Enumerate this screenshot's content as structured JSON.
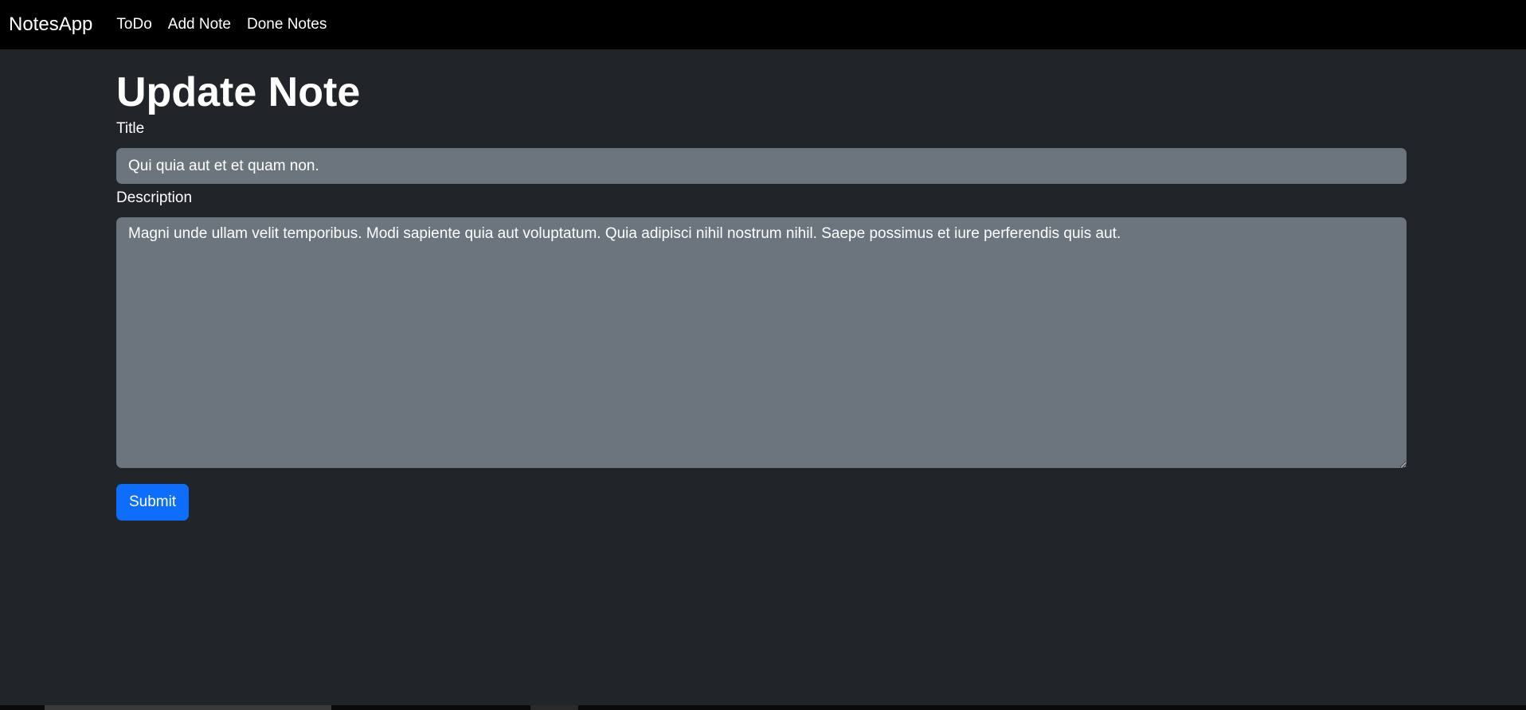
{
  "navbar": {
    "brand": "NotesApp",
    "links": [
      "ToDo",
      "Add Note",
      "Done Notes"
    ]
  },
  "form": {
    "heading": "Update Note",
    "title_label": "Title",
    "title_value": "Qui quia aut et et quam non.",
    "description_label": "Description",
    "description_value": "Magni unde ullam velit temporibus. Modi sapiente quia aut voluptatum. Quia adipisci nihil nostrum nihil. Saepe possimus et iure perferendis quis aut.",
    "submit_label": "Submit"
  },
  "colors": {
    "navbar_bg": "#000000",
    "page_bg": "#212529",
    "input_bg": "#6c757d",
    "primary": "#0d6efd"
  }
}
